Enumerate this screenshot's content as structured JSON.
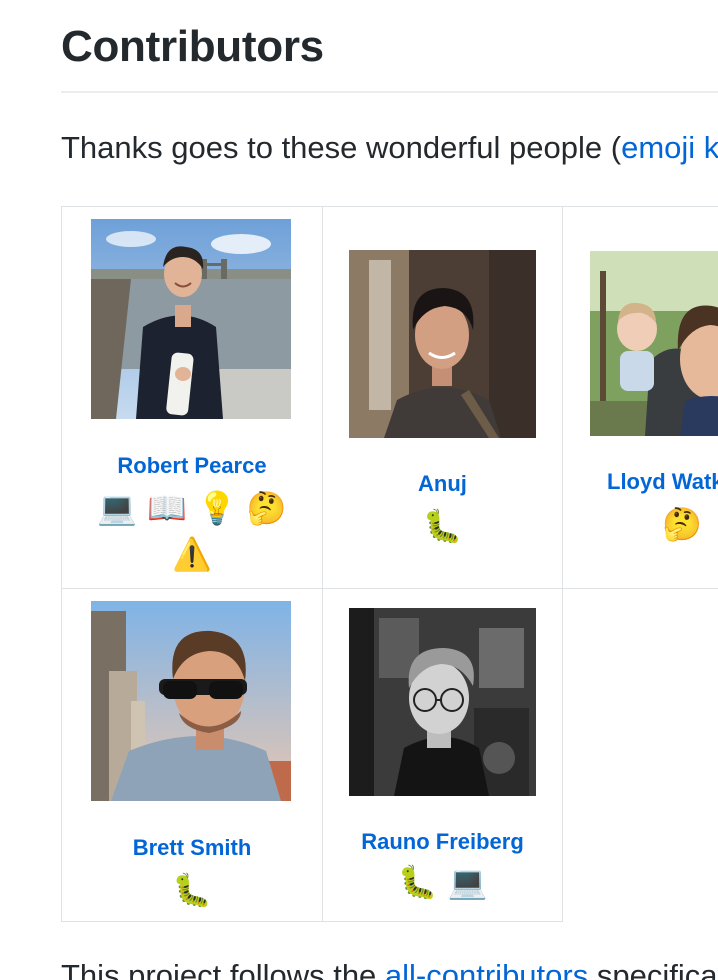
{
  "heading": "Contributors",
  "intro": {
    "text": "Thanks goes to these wonderful people (",
    "link": "emoji key"
  },
  "contributors": [
    {
      "name": "Robert Pearce",
      "contributions": [
        "💻",
        "📖",
        "💡",
        "🤔",
        "⚠️"
      ]
    },
    {
      "name": "Anuj",
      "contributions": [
        "🐛"
      ]
    },
    {
      "name": "Lloyd Watkin",
      "contributions": [
        "🤔"
      ]
    },
    {
      "name": "Brett Smith",
      "contributions": [
        "🐛"
      ]
    },
    {
      "name": "Rauno Freiberg",
      "contributions": [
        "🐛",
        "💻"
      ]
    }
  ],
  "footer": {
    "text_before": "This project follows the ",
    "link": "all-contributors",
    "text_after": " specification."
  }
}
